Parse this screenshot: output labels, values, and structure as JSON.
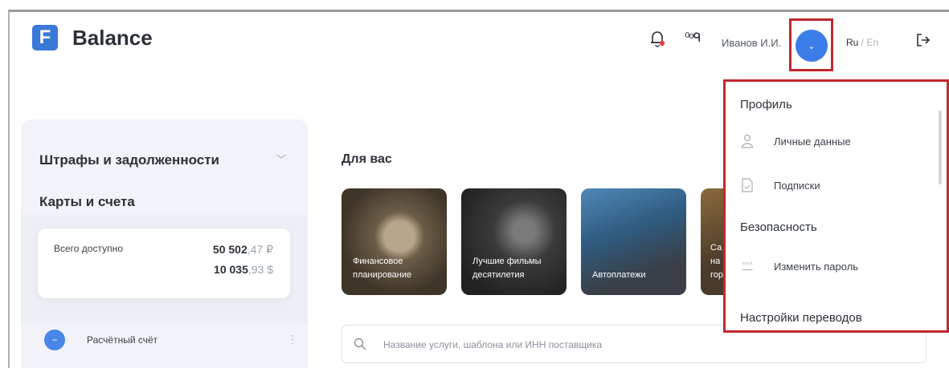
{
  "brand": {
    "logo_letter": "F",
    "name": "Balance",
    "accent": "#3b79d9"
  },
  "header": {
    "bell_icon": "bell-icon",
    "eyes_icon_text": "⁰ᵒᑫ",
    "user_name": "Иванов И.И.",
    "avatar_chevron": "⌄",
    "lang_active": "Ru",
    "lang_sep": " / ",
    "lang_inactive": "En",
    "logout_icon": "logout-icon"
  },
  "left": {
    "fines_title": "Штрафы и задолженности",
    "cards_title": "Карты и счета",
    "balance": {
      "label": "Всего доступно",
      "rub_main": "50 502",
      "rub_dec": ",47 ₽",
      "usd_main": "10 035",
      "usd_dec": ",93 $"
    },
    "account": {
      "icon": "−",
      "label": "Расчётный счёт",
      "more": "⋮"
    }
  },
  "for_you": {
    "title": "Для вас",
    "tiles": [
      {
        "label": "Финансовое\nпланирование"
      },
      {
        "label": "Лучшие фильмы\nдесятилетия"
      },
      {
        "label": "Автоплатежи"
      },
      {
        "label": "Са\nна\nгор"
      }
    ]
  },
  "search": {
    "placeholder": "Название услуги, шаблона или ИНН поставщика"
  },
  "menu": {
    "profile_title": "Профиль",
    "personal_data": "Личные данные",
    "subscriptions": "Подписки",
    "security_title": "Безопасность",
    "change_password": "Изменить пароль",
    "password_icon": "°°°",
    "transfers_title": "Настройки переводов"
  }
}
